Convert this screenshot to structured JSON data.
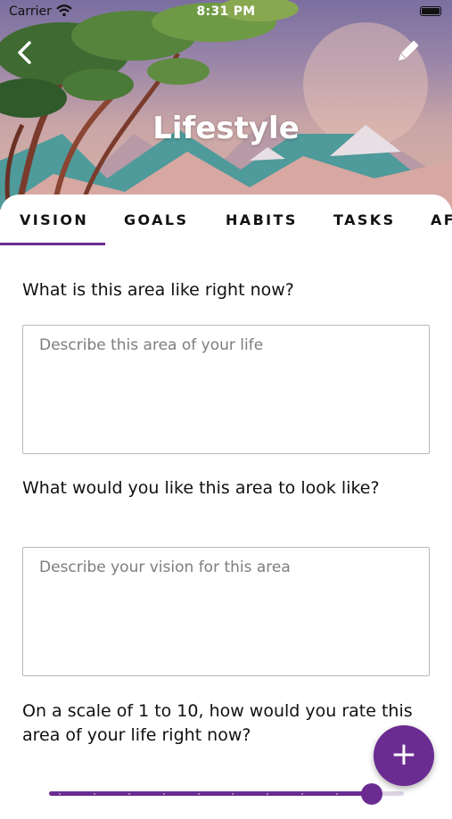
{
  "status_bar": {
    "carrier": "Carrier",
    "time": "8:31 PM"
  },
  "header": {
    "title": "Lifestyle",
    "back_icon": "chevron-left-icon",
    "edit_icon": "pencil-icon"
  },
  "tabs": [
    {
      "label": "VISION",
      "selected": true
    },
    {
      "label": "GOALS",
      "selected": false
    },
    {
      "label": "HABITS",
      "selected": false
    },
    {
      "label": "TASKS",
      "selected": false
    },
    {
      "label": "AF",
      "selected": false
    }
  ],
  "vision": {
    "q1": "What is this area like right now?",
    "q1_placeholder": "Describe this area of your life",
    "q2": "What would you like this area to look like?",
    "q2_placeholder": "Describe your vision for this area",
    "q3": "On a scale of 1 to 10, how would you rate this area of your life right now?"
  },
  "rating_slider": {
    "min": 1,
    "max": 10,
    "value": 10
  },
  "fab": {
    "label": "+"
  },
  "colors": {
    "accent": "#6a2c91"
  }
}
